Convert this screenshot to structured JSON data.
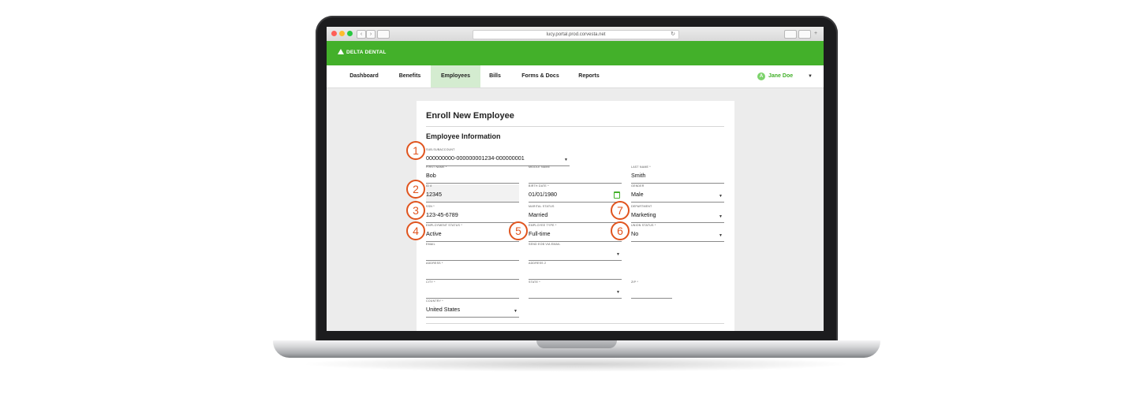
{
  "browser": {
    "url": "lucy.portal.prod.corvesta.net"
  },
  "brand": {
    "logo_text": "DELTA DENTAL",
    "color": "#43b02a"
  },
  "nav": {
    "items": [
      {
        "label": "Dashboard"
      },
      {
        "label": "Benefits"
      },
      {
        "label": "Employees"
      },
      {
        "label": "Bills"
      },
      {
        "label": "Forms & Docs"
      },
      {
        "label": "Reports"
      }
    ],
    "active": "Employees",
    "user": {
      "initial": "A",
      "name": "Jane Doe"
    }
  },
  "form": {
    "title": "Enroll New Employee",
    "section": "Employee Information",
    "fields": {
      "subaccount": {
        "label": "SUB-SUBACCOUNT",
        "value": "000000000-000000001234-000000001"
      },
      "first_name": {
        "label": "FIRST NAME *",
        "value": "Bob"
      },
      "middle_name": {
        "label": "MIDDLE NAME",
        "value": ""
      },
      "last_name": {
        "label": "LAST NAME *",
        "value": "Smith"
      },
      "id": {
        "label": "ID #",
        "value": "12345"
      },
      "birth_date": {
        "label": "BIRTH DATE *",
        "value": "01/01/1980"
      },
      "gender": {
        "label": "GENDER",
        "value": "Male"
      },
      "ssn": {
        "label": "SSN *",
        "value": "123-45-6789"
      },
      "marital_status": {
        "label": "MARITAL STATUS",
        "value": "Married"
      },
      "department": {
        "label": "DEPARTMENT",
        "value": "Marketing"
      },
      "employment_status": {
        "label": "EMPLOYMENT STATUS *",
        "value": "Active"
      },
      "employee_type": {
        "label": "EMPLOYEE TYPE *",
        "value": "Full-time"
      },
      "union_status": {
        "label": "UNION STATUS *",
        "value": "No"
      },
      "email": {
        "label": "EMAIL",
        "value": ""
      },
      "send_eob": {
        "label": "SEND EOB VIA EMAIL",
        "value": ""
      },
      "address": {
        "label": "ADDRESS *",
        "value": ""
      },
      "address2": {
        "label": "ADDRESS 2",
        "value": ""
      },
      "city": {
        "label": "CITY *",
        "value": ""
      },
      "state": {
        "label": "STATE *",
        "value": ""
      },
      "zip": {
        "label": "ZIP *",
        "value": ""
      },
      "country": {
        "label": "COUNTRY *",
        "value": "United States"
      }
    }
  },
  "markers": [
    "1",
    "2",
    "3",
    "4",
    "5",
    "6",
    "7"
  ],
  "marker_color": "#e0541e"
}
